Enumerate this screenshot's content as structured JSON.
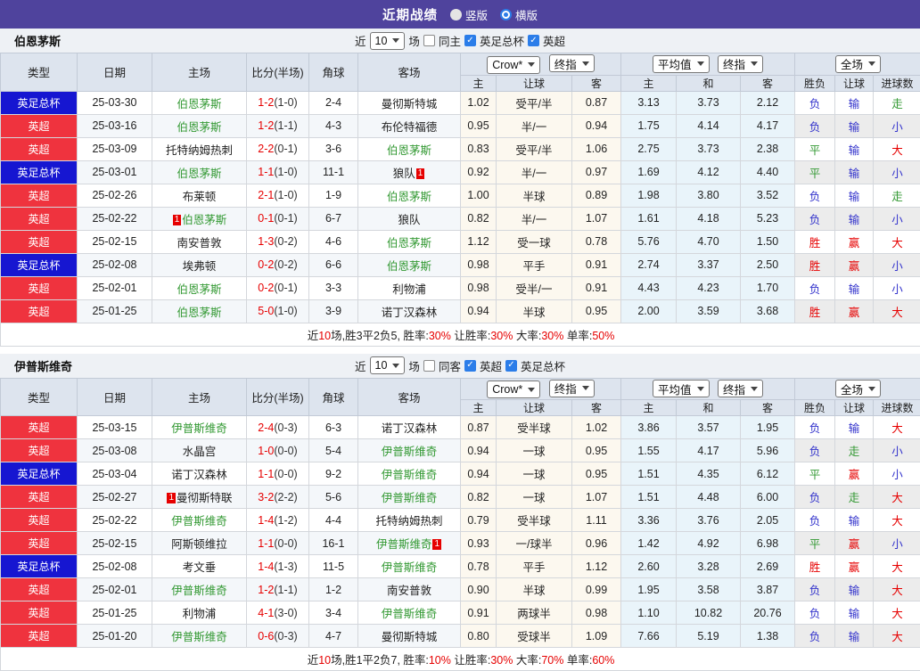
{
  "topbar": {
    "title": "近期战绩",
    "radios": [
      {
        "label": "竖版",
        "checked": false
      },
      {
        "label": "横版",
        "checked": true
      }
    ]
  },
  "colors": {
    "accent_purple": "#4f439d",
    "league_red": "#ef333e",
    "league_blue": "#1616d1",
    "team_green": "#339933",
    "score_red": "#e60000",
    "result_red": "#e60000",
    "result_blue": "#3333cc",
    "result_green": "#339933"
  },
  "sections": [
    {
      "team": "伯恩茅斯",
      "filters": {
        "near": "近",
        "count": "10",
        "games": "场",
        "same": {
          "label": "同主",
          "checked": false
        },
        "leagues": [
          {
            "label": "英足总杯",
            "checked": true
          },
          {
            "label": "英超",
            "checked": true
          }
        ]
      },
      "header": {
        "base_cols": [
          "类型",
          "日期",
          "主场",
          "比分(半场)",
          "角球",
          "客场"
        ],
        "group1_selects": [
          "Crow*",
          "终指"
        ],
        "group1_cols": [
          "主",
          "让球",
          "客"
        ],
        "group2_selects": [
          "平均值",
          "终指"
        ],
        "group2_cols": [
          "主",
          "和",
          "客"
        ],
        "group3_select": "全场",
        "group3_cols": [
          "胜负",
          "让球",
          "进球数"
        ]
      },
      "rows": [
        {
          "league": "英足总杯",
          "lc": "blue",
          "date": "25-03-30",
          "home": {
            "name": "伯恩茅斯",
            "green": true
          },
          "ft": "1-2",
          "ht": "(1-0)",
          "corner": "2-4",
          "away": {
            "name": "曼彻斯特城",
            "green": false
          },
          "o1": [
            "1.02",
            "受平/半",
            "0.87"
          ],
          "o2": [
            "3.13",
            "3.73",
            "2.12"
          ],
          "res": [
            [
              "负",
              "b"
            ],
            [
              "输",
              "b"
            ],
            [
              "走",
              "g"
            ]
          ]
        },
        {
          "league": "英超",
          "lc": "red",
          "date": "25-03-16",
          "home": {
            "name": "伯恩茅斯",
            "green": true
          },
          "ft": "1-2",
          "ht": "(1-1)",
          "corner": "4-3",
          "away": {
            "name": "布伦特福德",
            "green": false
          },
          "o1": [
            "0.95",
            "半/一",
            "0.94"
          ],
          "o2": [
            "1.75",
            "4.14",
            "4.17"
          ],
          "res": [
            [
              "负",
              "b"
            ],
            [
              "输",
              "b"
            ],
            [
              "小",
              "b"
            ]
          ]
        },
        {
          "league": "英超",
          "lc": "red",
          "date": "25-03-09",
          "home": {
            "name": "托特纳姆热刺",
            "green": false
          },
          "ft": "2-2",
          "ht": "(0-1)",
          "corner": "3-6",
          "away": {
            "name": "伯恩茅斯",
            "green": true
          },
          "o1": [
            "0.83",
            "受平/半",
            "1.06"
          ],
          "o2": [
            "2.75",
            "3.73",
            "2.38"
          ],
          "res": [
            [
              "平",
              "g"
            ],
            [
              "输",
              "b"
            ],
            [
              "大",
              "r"
            ]
          ]
        },
        {
          "league": "英足总杯",
          "lc": "blue",
          "date": "25-03-01",
          "home": {
            "name": "伯恩茅斯",
            "green": true
          },
          "ft": "1-1",
          "ht": "(1-0)",
          "corner": "11-1",
          "away": {
            "name": "狼队",
            "green": false,
            "badge": "1",
            "badge_pos": "after"
          },
          "o1": [
            "0.92",
            "半/一",
            "0.97"
          ],
          "o2": [
            "1.69",
            "4.12",
            "4.40"
          ],
          "res": [
            [
              "平",
              "g"
            ],
            [
              "输",
              "b"
            ],
            [
              "小",
              "b"
            ]
          ]
        },
        {
          "league": "英超",
          "lc": "red",
          "date": "25-02-26",
          "home": {
            "name": "布莱顿",
            "green": false
          },
          "ft": "2-1",
          "ht": "(1-0)",
          "corner": "1-9",
          "away": {
            "name": "伯恩茅斯",
            "green": true
          },
          "o1": [
            "1.00",
            "半球",
            "0.89"
          ],
          "o2": [
            "1.98",
            "3.80",
            "3.52"
          ],
          "res": [
            [
              "负",
              "b"
            ],
            [
              "输",
              "b"
            ],
            [
              "走",
              "g"
            ]
          ]
        },
        {
          "league": "英超",
          "lc": "red",
          "date": "25-02-22",
          "home": {
            "name": "伯恩茅斯",
            "green": true,
            "badge": "1",
            "badge_pos": "before"
          },
          "ft": "0-1",
          "ht": "(0-1)",
          "corner": "6-7",
          "away": {
            "name": "狼队",
            "green": false
          },
          "o1": [
            "0.82",
            "半/一",
            "1.07"
          ],
          "o2": [
            "1.61",
            "4.18",
            "5.23"
          ],
          "res": [
            [
              "负",
              "b"
            ],
            [
              "输",
              "b"
            ],
            [
              "小",
              "b"
            ]
          ]
        },
        {
          "league": "英超",
          "lc": "red",
          "date": "25-02-15",
          "home": {
            "name": "南安普敦",
            "green": false
          },
          "ft": "1-3",
          "ht": "(0-2)",
          "corner": "4-6",
          "away": {
            "name": "伯恩茅斯",
            "green": true
          },
          "o1": [
            "1.12",
            "受一球",
            "0.78"
          ],
          "o2": [
            "5.76",
            "4.70",
            "1.50"
          ],
          "res": [
            [
              "胜",
              "r"
            ],
            [
              "赢",
              "r"
            ],
            [
              "大",
              "r"
            ]
          ]
        },
        {
          "league": "英足总杯",
          "lc": "blue",
          "date": "25-02-08",
          "home": {
            "name": "埃弗顿",
            "green": false
          },
          "ft": "0-2",
          "ht": "(0-2)",
          "corner": "6-6",
          "away": {
            "name": "伯恩茅斯",
            "green": true
          },
          "o1": [
            "0.98",
            "平手",
            "0.91"
          ],
          "o2": [
            "2.74",
            "3.37",
            "2.50"
          ],
          "res": [
            [
              "胜",
              "r"
            ],
            [
              "赢",
              "r"
            ],
            [
              "小",
              "b"
            ]
          ]
        },
        {
          "league": "英超",
          "lc": "red",
          "date": "25-02-01",
          "home": {
            "name": "伯恩茅斯",
            "green": true
          },
          "ft": "0-2",
          "ht": "(0-1)",
          "corner": "3-3",
          "away": {
            "name": "利物浦",
            "green": false
          },
          "o1": [
            "0.98",
            "受半/一",
            "0.91"
          ],
          "o2": [
            "4.43",
            "4.23",
            "1.70"
          ],
          "res": [
            [
              "负",
              "b"
            ],
            [
              "输",
              "b"
            ],
            [
              "小",
              "b"
            ]
          ]
        },
        {
          "league": "英超",
          "lc": "red",
          "date": "25-01-25",
          "home": {
            "name": "伯恩茅斯",
            "green": true
          },
          "ft": "5-0",
          "ht": "(1-0)",
          "corner": "3-9",
          "away": {
            "name": "诺丁汉森林",
            "green": false
          },
          "o1": [
            "0.94",
            "半球",
            "0.95"
          ],
          "o2": [
            "2.00",
            "3.59",
            "3.68"
          ],
          "res": [
            [
              "胜",
              "r"
            ],
            [
              "赢",
              "r"
            ],
            [
              "大",
              "r"
            ]
          ]
        }
      ],
      "summary": [
        {
          "text": "近",
          "red": false
        },
        {
          "text": "10",
          "red": true
        },
        {
          "text": "场,胜3平2负5, 胜率:",
          "red": false
        },
        {
          "text": "30%",
          "red": true
        },
        {
          "text": " 让胜率:",
          "red": false
        },
        {
          "text": "30%",
          "red": true
        },
        {
          "text": " 大率:",
          "red": false
        },
        {
          "text": "30%",
          "red": true
        },
        {
          "text": " 单率:",
          "red": false
        },
        {
          "text": "50%",
          "red": true
        }
      ]
    },
    {
      "team": "伊普斯维奇",
      "filters": {
        "near": "近",
        "count": "10",
        "games": "场",
        "same": {
          "label": "同客",
          "checked": false
        },
        "leagues": [
          {
            "label": "英超",
            "checked": true
          },
          {
            "label": "英足总杯",
            "checked": true
          }
        ]
      },
      "header": {
        "base_cols": [
          "类型",
          "日期",
          "主场",
          "比分(半场)",
          "角球",
          "客场"
        ],
        "group1_selects": [
          "Crow*",
          "终指"
        ],
        "group1_cols": [
          "主",
          "让球",
          "客"
        ],
        "group2_selects": [
          "平均值",
          "终指"
        ],
        "group2_cols": [
          "主",
          "和",
          "客"
        ],
        "group3_select": "全场",
        "group3_cols": [
          "胜负",
          "让球",
          "进球数"
        ]
      },
      "rows": [
        {
          "league": "英超",
          "lc": "red",
          "date": "25-03-15",
          "home": {
            "name": "伊普斯维奇",
            "green": true
          },
          "ft": "2-4",
          "ht": "(0-3)",
          "corner": "6-3",
          "away": {
            "name": "诺丁汉森林",
            "green": false
          },
          "o1": [
            "0.87",
            "受半球",
            "1.02"
          ],
          "o2": [
            "3.86",
            "3.57",
            "1.95"
          ],
          "res": [
            [
              "负",
              "b"
            ],
            [
              "输",
              "b"
            ],
            [
              "大",
              "r"
            ]
          ]
        },
        {
          "league": "英超",
          "lc": "red",
          "date": "25-03-08",
          "home": {
            "name": "水晶宫",
            "green": false
          },
          "ft": "1-0",
          "ht": "(0-0)",
          "corner": "5-4",
          "away": {
            "name": "伊普斯维奇",
            "green": true
          },
          "o1": [
            "0.94",
            "一球",
            "0.95"
          ],
          "o2": [
            "1.55",
            "4.17",
            "5.96"
          ],
          "res": [
            [
              "负",
              "b"
            ],
            [
              "走",
              "g"
            ],
            [
              "小",
              "b"
            ]
          ]
        },
        {
          "league": "英足总杯",
          "lc": "blue",
          "date": "25-03-04",
          "home": {
            "name": "诺丁汉森林",
            "green": false
          },
          "ft": "1-1",
          "ht": "(0-0)",
          "corner": "9-2",
          "away": {
            "name": "伊普斯维奇",
            "green": true
          },
          "o1": [
            "0.94",
            "一球",
            "0.95"
          ],
          "o2": [
            "1.51",
            "4.35",
            "6.12"
          ],
          "res": [
            [
              "平",
              "g"
            ],
            [
              "赢",
              "r"
            ],
            [
              "小",
              "b"
            ]
          ]
        },
        {
          "league": "英超",
          "lc": "red",
          "date": "25-02-27",
          "home": {
            "name": "曼彻斯特联",
            "green": false,
            "badge": "1",
            "badge_pos": "before"
          },
          "ft": "3-2",
          "ht": "(2-2)",
          "corner": "5-6",
          "away": {
            "name": "伊普斯维奇",
            "green": true
          },
          "o1": [
            "0.82",
            "一球",
            "1.07"
          ],
          "o2": [
            "1.51",
            "4.48",
            "6.00"
          ],
          "res": [
            [
              "负",
              "b"
            ],
            [
              "走",
              "g"
            ],
            [
              "大",
              "r"
            ]
          ]
        },
        {
          "league": "英超",
          "lc": "red",
          "date": "25-02-22",
          "home": {
            "name": "伊普斯维奇",
            "green": true
          },
          "ft": "1-4",
          "ht": "(1-2)",
          "corner": "4-4",
          "away": {
            "name": "托特纳姆热刺",
            "green": false
          },
          "o1": [
            "0.79",
            "受半球",
            "1.11"
          ],
          "o2": [
            "3.36",
            "3.76",
            "2.05"
          ],
          "res": [
            [
              "负",
              "b"
            ],
            [
              "输",
              "b"
            ],
            [
              "大",
              "r"
            ]
          ]
        },
        {
          "league": "英超",
          "lc": "red",
          "date": "25-02-15",
          "home": {
            "name": "阿斯顿维拉",
            "green": false
          },
          "ft": "1-1",
          "ht": "(0-0)",
          "corner": "16-1",
          "away": {
            "name": "伊普斯维奇",
            "green": true,
            "badge": "1",
            "badge_pos": "after"
          },
          "o1": [
            "0.93",
            "一/球半",
            "0.96"
          ],
          "o2": [
            "1.42",
            "4.92",
            "6.98"
          ],
          "res": [
            [
              "平",
              "g"
            ],
            [
              "赢",
              "r"
            ],
            [
              "小",
              "b"
            ]
          ]
        },
        {
          "league": "英足总杯",
          "lc": "blue",
          "date": "25-02-08",
          "home": {
            "name": "考文垂",
            "green": false
          },
          "ft": "1-4",
          "ht": "(1-3)",
          "corner": "11-5",
          "away": {
            "name": "伊普斯维奇",
            "green": true
          },
          "o1": [
            "0.78",
            "平手",
            "1.12"
          ],
          "o2": [
            "2.60",
            "3.28",
            "2.69"
          ],
          "res": [
            [
              "胜",
              "r"
            ],
            [
              "赢",
              "r"
            ],
            [
              "大",
              "r"
            ]
          ]
        },
        {
          "league": "英超",
          "lc": "red",
          "date": "25-02-01",
          "home": {
            "name": "伊普斯维奇",
            "green": true
          },
          "ft": "1-2",
          "ht": "(1-1)",
          "corner": "1-2",
          "away": {
            "name": "南安普敦",
            "green": false
          },
          "o1": [
            "0.90",
            "半球",
            "0.99"
          ],
          "o2": [
            "1.95",
            "3.58",
            "3.87"
          ],
          "res": [
            [
              "负",
              "b"
            ],
            [
              "输",
              "b"
            ],
            [
              "大",
              "r"
            ]
          ]
        },
        {
          "league": "英超",
          "lc": "red",
          "date": "25-01-25",
          "home": {
            "name": "利物浦",
            "green": false
          },
          "ft": "4-1",
          "ht": "(3-0)",
          "corner": "3-4",
          "away": {
            "name": "伊普斯维奇",
            "green": true
          },
          "o1": [
            "0.91",
            "两球半",
            "0.98"
          ],
          "o2": [
            "1.10",
            "10.82",
            "20.76"
          ],
          "res": [
            [
              "负",
              "b"
            ],
            [
              "输",
              "b"
            ],
            [
              "大",
              "r"
            ]
          ]
        },
        {
          "league": "英超",
          "lc": "red",
          "date": "25-01-20",
          "home": {
            "name": "伊普斯维奇",
            "green": true
          },
          "ft": "0-6",
          "ht": "(0-3)",
          "corner": "4-7",
          "away": {
            "name": "曼彻斯特城",
            "green": false
          },
          "o1": [
            "0.80",
            "受球半",
            "1.09"
          ],
          "o2": [
            "7.66",
            "5.19",
            "1.38"
          ],
          "res": [
            [
              "负",
              "b"
            ],
            [
              "输",
              "b"
            ],
            [
              "大",
              "r"
            ]
          ]
        }
      ],
      "summary": [
        {
          "text": "近",
          "red": false
        },
        {
          "text": "10",
          "red": true
        },
        {
          "text": "场,胜1平2负7, 胜率:",
          "red": false
        },
        {
          "text": "10%",
          "red": true
        },
        {
          "text": " 让胜率:",
          "red": false
        },
        {
          "text": "30%",
          "red": true
        },
        {
          "text": " 大率:",
          "red": false
        },
        {
          "text": "70%",
          "red": true
        },
        {
          "text": " 单率:",
          "red": false
        },
        {
          "text": "60%",
          "red": true
        }
      ]
    }
  ]
}
